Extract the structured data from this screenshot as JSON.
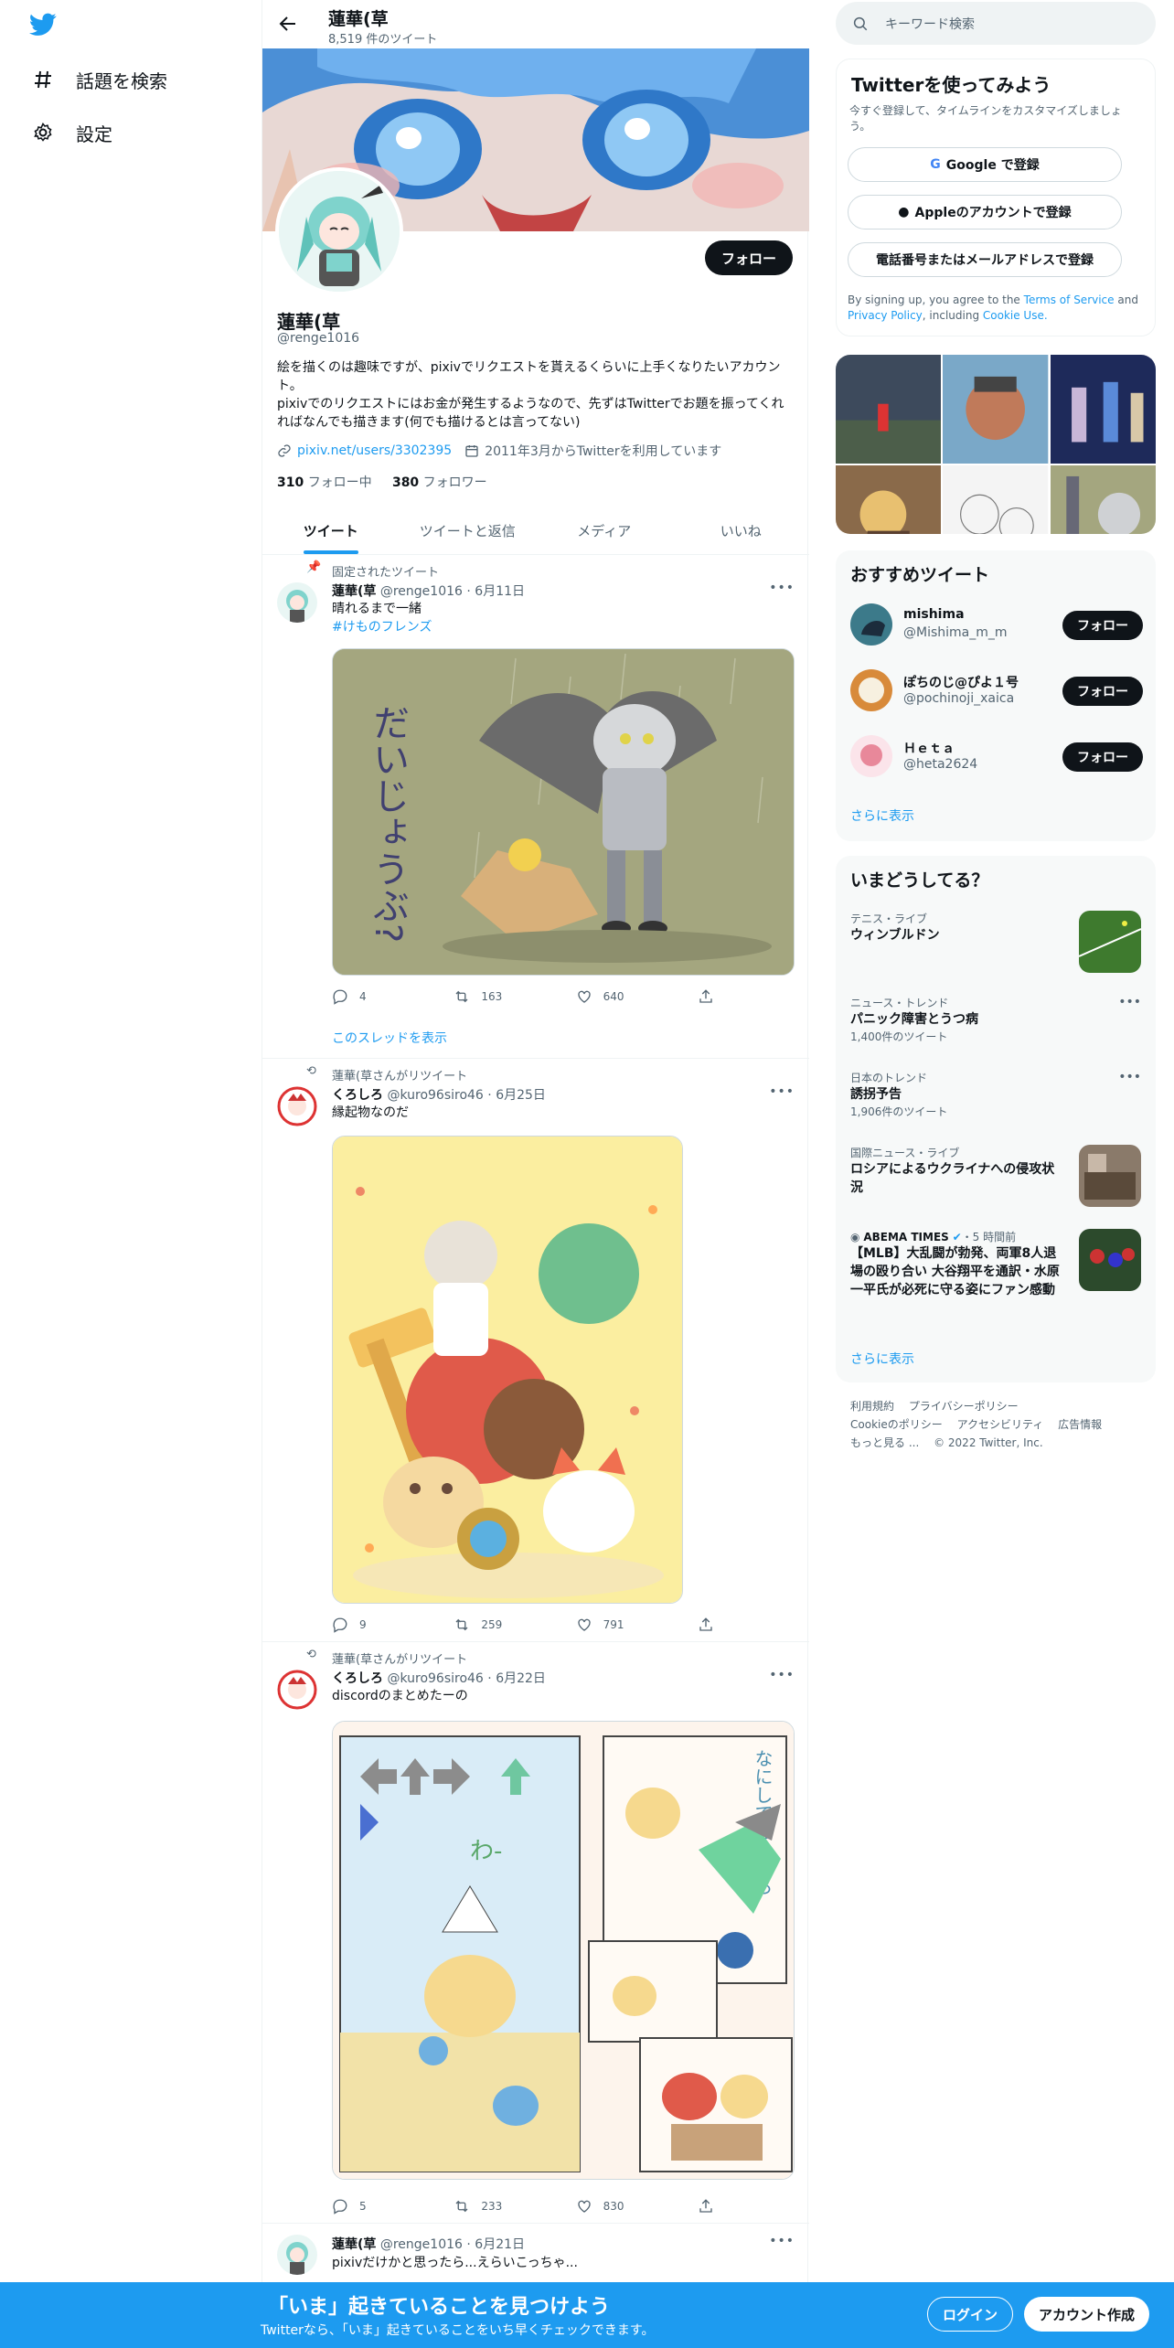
{
  "nav": {
    "items": [
      {
        "label": "話題を検索",
        "icon": "hashtag-icon"
      },
      {
        "label": "設定",
        "icon": "gear-icon"
      }
    ]
  },
  "header": {
    "name": "蓮華(草",
    "tweet_count": "8,519 件のツイート"
  },
  "profile": {
    "name": "蓮華(草",
    "handle": "@renge1016",
    "follow_label": "フォロー",
    "bio": "絵を描くのは趣味ですが、pixivでリクエストを貰えるくらいに上手くなりたいアカウント。\npixivでのリクエストにはお金が発生するようなので、先ずはTwitterでお題を振ってくれればなんでも描きます(何でも描けるとは言ってない)",
    "link": "pixiv.net/users/3302395",
    "joined": "2011年3月からTwitterを利用しています",
    "following_count": "310",
    "following_label": "フォロー中",
    "followers_count": "380",
    "followers_label": "フォロワー"
  },
  "tabs": [
    "ツイート",
    "ツイートと返信",
    "メディア",
    "いいね"
  ],
  "tweets": [
    {
      "context": "固定されたツイート",
      "name": "蓮華(草",
      "handle": "@renge1016",
      "date": "6月11日",
      "text": "晴れるまで一緒",
      "hashtag": "#けものフレンズ",
      "image_text": "だいじょうぶ?",
      "replies": "4",
      "retweets": "163",
      "likes": "640",
      "thread_link": "このスレッドを表示"
    },
    {
      "context": "蓮華(草さんがリツイート",
      "name": "くろしろ",
      "handle": "@kuro96siro46",
      "date": "6月25日",
      "text": "縁起物なのだ",
      "replies": "9",
      "retweets": "259",
      "likes": "791"
    },
    {
      "context": "蓮華(草さんがリツイート",
      "name": "くろしろ",
      "handle": "@kuro96siro46",
      "date": "6月22日",
      "text": "discordのまとめたーの",
      "image_text_1": "わ-",
      "image_text_2": "なにしてるんだろ",
      "replies": "5",
      "retweets": "233",
      "likes": "830"
    },
    {
      "name": "蓮華(草",
      "handle": "@renge1016",
      "date": "6月21日",
      "text": "pixivだけかと思ったら...えらいこっちゃ..."
    }
  ],
  "right": {
    "search_placeholder": "キーワード検索",
    "signup": {
      "title": "Twitterを使ってみよう",
      "subtitle": "今すぐ登録して、タイムラインをカスタマイズしましょう。",
      "google": "Google で登録",
      "apple": "Appleのアカウントで登録",
      "phone": "電話番号またはメールアドレスで登録",
      "terms_prefix": "By signing up, you agree to the",
      "terms_link": "Terms of Service",
      "and": "and",
      "privacy_link": "Privacy Policy",
      "including": ", including",
      "cookie_link": "Cookie Use."
    },
    "recommend": {
      "title": "おすすめツイート",
      "users": [
        {
          "name": "mishima",
          "handle": "@Mishima_m_m",
          "button": "フォロー"
        },
        {
          "name": "ぽちのじ@ぴよ１号",
          "handle": "@pochinoji_xaica",
          "button": "フォロー"
        },
        {
          "name": "Ｈｅｔａ",
          "handle": "@heta2624",
          "button": "フォロー"
        }
      ],
      "show_more": "さらに表示"
    },
    "trends": {
      "title": "いまどうしてる？",
      "items": [
        {
          "category": "テニス・ライブ",
          "title": "ウィンブルドン"
        },
        {
          "category": "ニュース・トレンド",
          "title": "パニック障害とうつ病",
          "count": "1,400件のツイート"
        },
        {
          "category": "日本のトレンド",
          "title": "誘拐予告",
          "count": "1,906件のツイート"
        },
        {
          "category": "国際ニュース・ライブ",
          "title": "ロシアによるウクライナへの侵攻状況"
        },
        {
          "category": "ABEMA TIMES",
          "time": "・5 時間前",
          "title": "【MLB】大乱闘が勃発、両軍8人退場の殴り合い 大谷翔平を通訳・水原一平氏が必死に守る姿にファン感動"
        }
      ],
      "show_more": "さらに表示"
    },
    "footer": {
      "links": [
        "利用規約",
        "プライバシーポリシー",
        "Cookieのポリシー",
        "アクセシビリティ",
        "広告情報",
        "もっと見る ..."
      ],
      "copyright": "© 2022 Twitter, Inc."
    }
  },
  "bottom_bar": {
    "headline": "「いま」起きていることを見つけよう",
    "sub": "Twitterなら、「いま」起きていることをいち早くチェックできます。",
    "login": "ログイン",
    "signup": "アカウント作成"
  },
  "colors": {
    "accent": "#1d9bf0",
    "text": "#0f1419",
    "secondary": "#536471",
    "border": "#eff3f4"
  }
}
